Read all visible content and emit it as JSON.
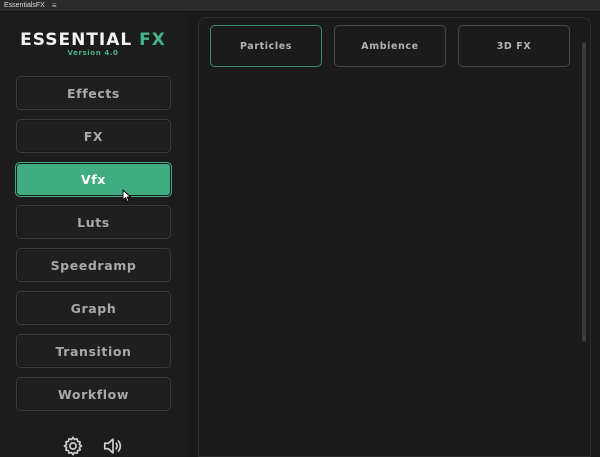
{
  "window": {
    "title": "EssentialsFX",
    "menu_glyph": "≡"
  },
  "header": {
    "logo_main": "ESSENTIAL",
    "logo_accent": "FX",
    "version": "Version 4.0",
    "accent_color": "#45b487"
  },
  "sidebar": {
    "items": [
      {
        "label": "Effects",
        "active": false
      },
      {
        "label": "FX",
        "active": false
      },
      {
        "label": "Vfx",
        "active": true
      },
      {
        "label": "Luts",
        "active": false
      },
      {
        "label": "Speedramp",
        "active": false
      },
      {
        "label": "Graph",
        "active": false
      },
      {
        "label": "Transition",
        "active": false
      },
      {
        "label": "Workflow",
        "active": false
      }
    ],
    "bottom_icons": [
      "gear-icon",
      "speaker-icon"
    ]
  },
  "main": {
    "tabs": [
      {
        "label": "Particles",
        "active": true
      },
      {
        "label": "Ambience",
        "active": false
      },
      {
        "label": "3D FX",
        "active": false
      }
    ]
  }
}
